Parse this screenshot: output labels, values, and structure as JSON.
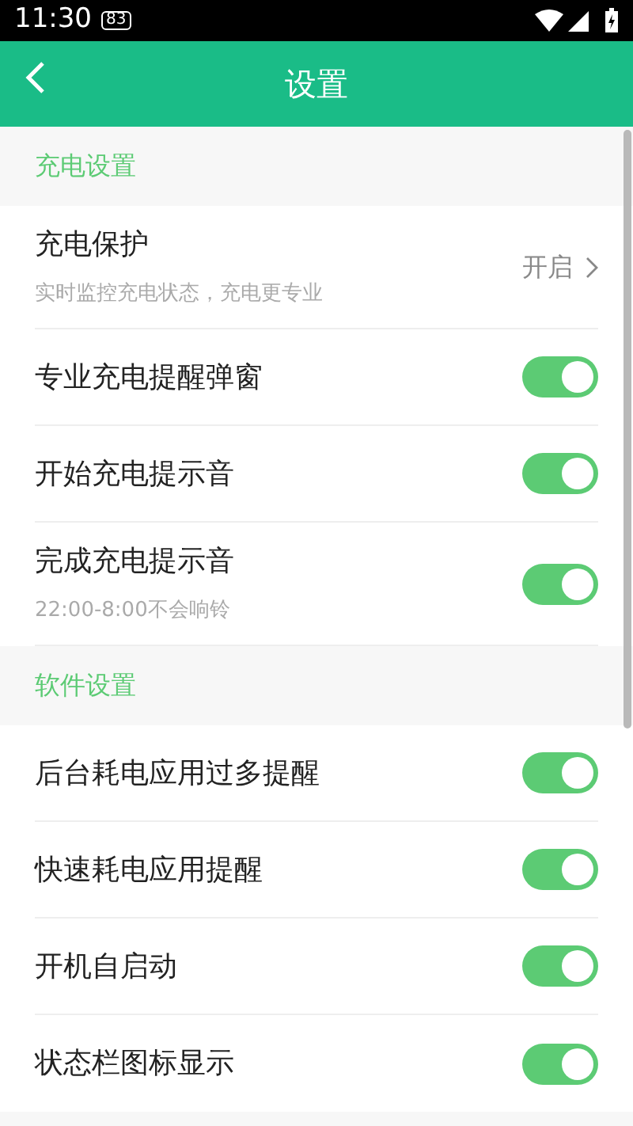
{
  "status_bar": {
    "time": "11:30",
    "notification": "83"
  },
  "header": {
    "title": "设置"
  },
  "sections": [
    {
      "title": "充电设置",
      "items": [
        {
          "kind": "link",
          "label": "充电保护",
          "subtitle": "实时监控充电状态，充电更专业",
          "value": "开启"
        },
        {
          "kind": "toggle",
          "label": "专业充电提醒弹窗",
          "on": true
        },
        {
          "kind": "toggle",
          "label": "开始充电提示音",
          "on": true
        },
        {
          "kind": "toggle",
          "label": "完成充电提示音",
          "subtitle": "22:00-8:00不会响铃",
          "on": true
        }
      ]
    },
    {
      "title": "软件设置",
      "items": [
        {
          "kind": "toggle",
          "label": "后台耗电应用过多提醒",
          "on": true
        },
        {
          "kind": "toggle",
          "label": "快速耗电应用提醒",
          "on": true
        },
        {
          "kind": "toggle",
          "label": "开机自启动",
          "on": true
        },
        {
          "kind": "toggle",
          "label": "状态栏图标显示",
          "on": true
        }
      ]
    }
  ]
}
